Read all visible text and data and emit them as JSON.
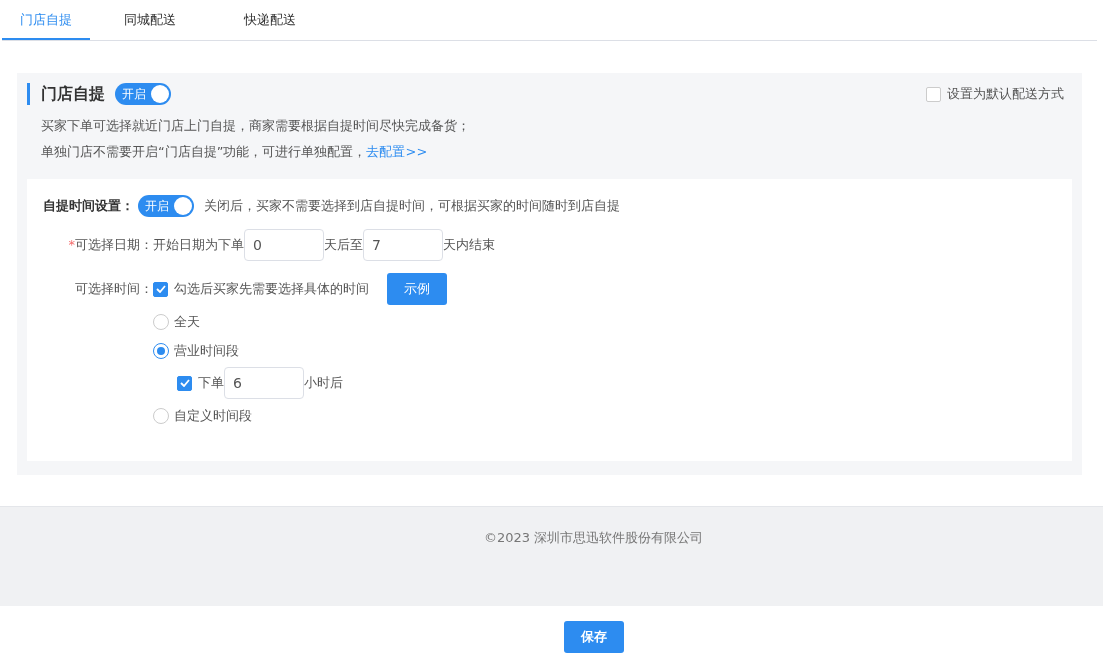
{
  "tabs": [
    {
      "label": "门店自提",
      "selected": true
    },
    {
      "label": "同城配送",
      "selected": false
    },
    {
      "label": "快递配送",
      "selected": false
    }
  ],
  "section": {
    "title": "门店自提",
    "toggle": {
      "label": "开启",
      "on": true
    },
    "default_option": {
      "label": "设置为默认配送方式",
      "checked": false
    },
    "description": "买家下单可选择就近门店上门自提，商家需要根据自提时间尽快完成备货；",
    "note": "单独门店不需要开启“门店自提”功能，可进行单独配置，",
    "note_link": "去配置>>"
  },
  "time_setting": {
    "label": "自提时间设置：",
    "toggle": {
      "label": "开启",
      "on": true
    },
    "hint": "关闭后，买家不需要选择到店自提时间，可根据买家的时间随时到店自提"
  },
  "date_range": {
    "required_mark": "*",
    "label": "可选择日期：",
    "prefix": "开始日期为下单",
    "start": "0",
    "middle": "天后至",
    "end": "7",
    "suffix": "天内结束"
  },
  "time_select": {
    "label": "可选择时间：",
    "checkbox_label": "勾选后买家先需要选择具体的时间",
    "checked": true,
    "example_button": "示例",
    "options": [
      {
        "label": "全天",
        "selected": false
      },
      {
        "label": "营业时间段",
        "selected": true,
        "rule": {
          "checked": true,
          "prefix": "下单",
          "value": "6",
          "suffix": "小时后"
        }
      },
      {
        "label": "自定义时间段",
        "selected": false
      }
    ]
  },
  "footer": {
    "copyright": "©2023 深圳市思迅软件股份有限公司"
  },
  "save_button": "保存"
}
